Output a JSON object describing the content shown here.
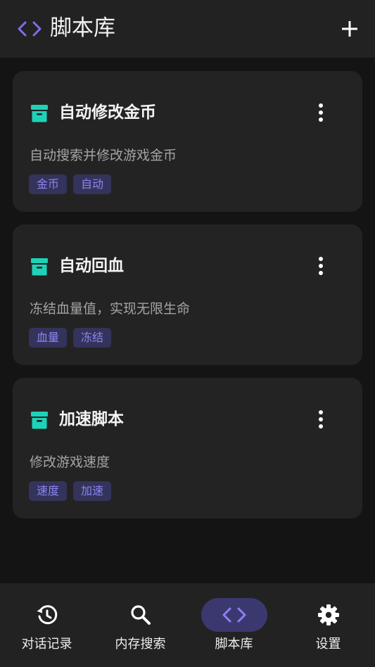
{
  "header": {
    "title": "脚本库",
    "icon": "code-icon",
    "add_icon": "plus-icon"
  },
  "colors": {
    "accent": "#7c6ff0",
    "teal": "#1ed2b9",
    "background": "#141414",
    "surface": "#232323",
    "tag_bg": "#34335b",
    "tag_text": "#8c86f2"
  },
  "scripts": [
    {
      "title": "自动修改金币",
      "description": "自动搜索并修改游戏金币",
      "tags": [
        "金币",
        "自动"
      ]
    },
    {
      "title": "自动回血",
      "description": "冻结血量值，实现无限生命",
      "tags": [
        "血量",
        "冻结"
      ]
    },
    {
      "title": "加速脚本",
      "description": "修改游戏速度",
      "tags": [
        "速度",
        "加速"
      ]
    }
  ],
  "nav": {
    "items": [
      {
        "label": "对话记录",
        "icon": "history-icon",
        "active": false
      },
      {
        "label": "内存搜索",
        "icon": "search-icon",
        "active": false
      },
      {
        "label": "脚本库",
        "icon": "code-icon",
        "active": true
      },
      {
        "label": "设置",
        "icon": "gear-icon",
        "active": false
      }
    ]
  }
}
